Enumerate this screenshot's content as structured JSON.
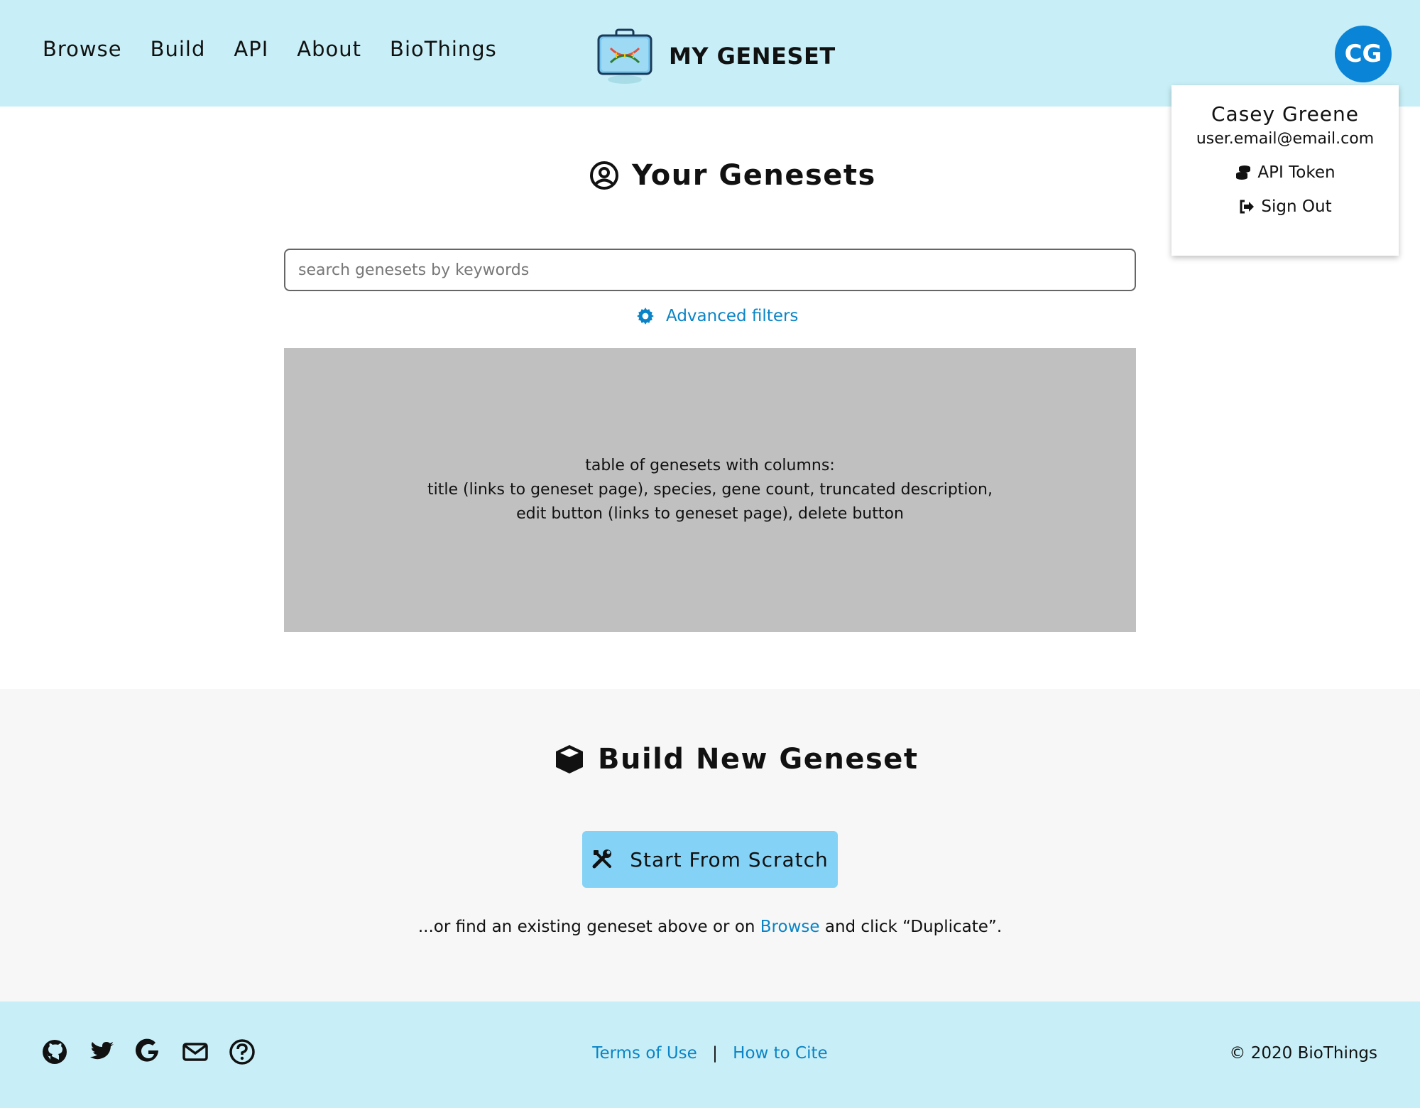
{
  "header": {
    "nav": [
      "Browse",
      "Build",
      "API",
      "About",
      "BioThings"
    ],
    "brand": "MY GENESET",
    "avatar_initials": "CG"
  },
  "user_menu": {
    "name": "Casey Greene",
    "email": "user.email@email.com",
    "api_token": "API Token",
    "sign_out": "Sign Out"
  },
  "genesets": {
    "title": "Your Genesets",
    "search_placeholder": "search genesets by keywords",
    "advanced_filters": "Advanced filters",
    "table_placeholder": [
      "table of genesets with columns:",
      "title (links to geneset page), species, gene count, truncated description,",
      "edit button (links to geneset page), delete button"
    ]
  },
  "build": {
    "title": "Build New Geneset",
    "start_button": "Start From Scratch",
    "hint_prefix": "...or find an existing geneset above or on",
    "hint_link": "Browse",
    "hint_suffix": "and click “Duplicate”."
  },
  "footer": {
    "icons": [
      "github-icon",
      "twitter-icon",
      "google-icon",
      "mail-icon",
      "help-icon"
    ],
    "terms": "Terms of Use",
    "separator": "|",
    "cite": "How to Cite",
    "copyright": "© 2020 BioThings"
  },
  "colors": {
    "header_bg": "#c8eff7",
    "accent": "#0a84d6",
    "button_bg": "#84d2f6",
    "placeholder_bg": "#c0c0c0"
  }
}
